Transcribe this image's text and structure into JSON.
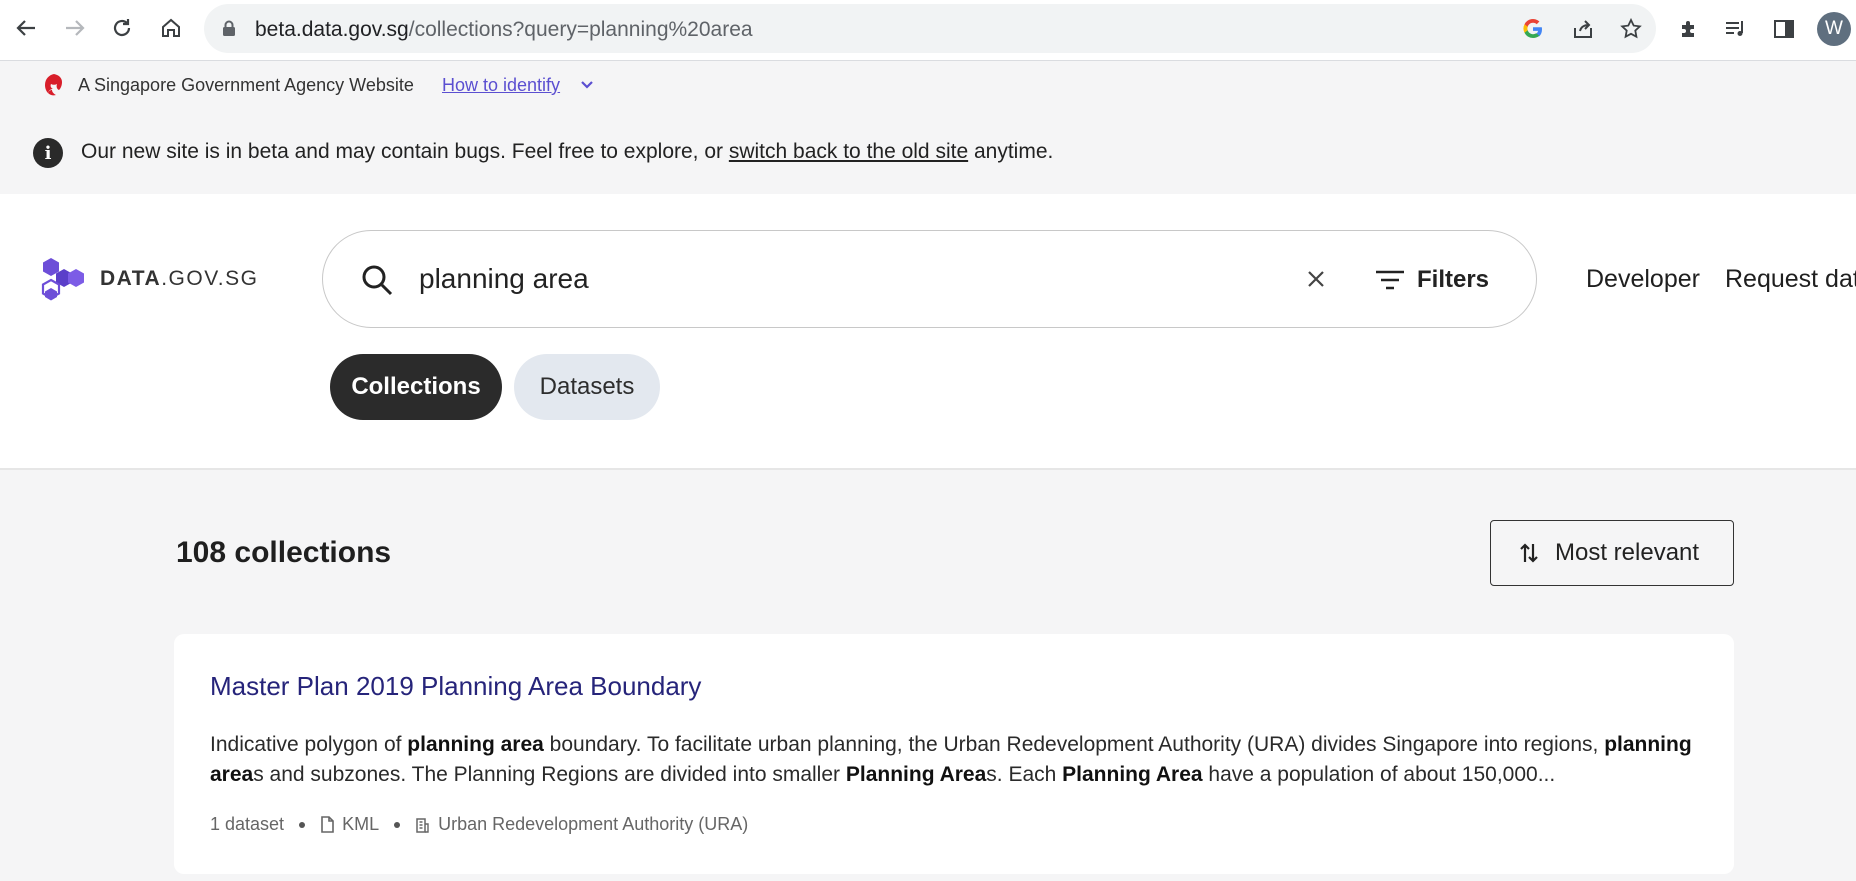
{
  "browser": {
    "url_host": "beta.data.gov.sg",
    "url_path": "/collections?query=planning%20area",
    "avatar_initial": "W"
  },
  "masthead": {
    "text": "A Singapore Government Agency Website",
    "link": "How to identify"
  },
  "beta_banner": {
    "text_before": "Our new site is in beta and may contain bugs. Feel free to explore, or ",
    "link": "switch back to the old site",
    "text_after": " anytime."
  },
  "header": {
    "logo_bold": "DATA",
    "logo_rest": ".GOV.SG",
    "search_value": "planning area",
    "filters_label": "Filters",
    "nav": [
      "Developer",
      "Request dat"
    ],
    "tabs": [
      "Collections",
      "Datasets"
    ],
    "active_tab": "Collections"
  },
  "results": {
    "count_label": "108 collections",
    "sort_label": "Most relevant",
    "items": [
      {
        "title": "Master Plan 2019 Planning Area Boundary",
        "desc_segments": [
          {
            "t": "Indicative polygon of ",
            "b": false
          },
          {
            "t": "planning area",
            "b": true
          },
          {
            "t": " boundary. To facilitate urban planning, the Urban Redevelopment Authority (URA) divides Singapore into regions, ",
            "b": false
          },
          {
            "t": "planning area",
            "b": true
          },
          {
            "t": "s and subzones. The Planning Regions are divided into smaller ",
            "b": false
          },
          {
            "t": "Planning Area",
            "b": true
          },
          {
            "t": "s. Each ",
            "b": false
          },
          {
            "t": "Planning Area",
            "b": true
          },
          {
            "t": " have a population of about 150,000...",
            "b": false
          }
        ],
        "dataset_count": "1 dataset",
        "format": "KML",
        "agency": "Urban Redevelopment Authority (URA)"
      }
    ]
  }
}
